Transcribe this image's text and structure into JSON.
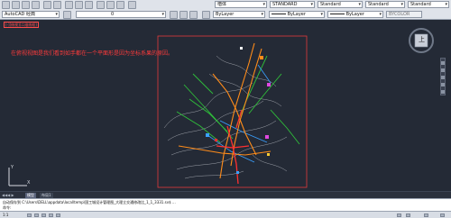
{
  "toolbar": {
    "workspace": "AutoCAD 经典",
    "layer_state": "0",
    "layer_dropdown": "ByLayer",
    "linetype_dropdown": "ByLayer",
    "lineweight_dropdown": "ByLayer",
    "plotstyle_dropdown": "BYCOLOR",
    "textstyle_dropdown": "STANDARD",
    "dimstyle_dropdown": "Standard",
    "tablestyle_dropdown": "Standard",
    "mleaderstyle_dropdown": "Standard",
    "font_dropdown": "楷体"
  },
  "viewport": {
    "label": "[-][俯视][二维线框]",
    "annotation": "在俯视视图是我们看到如手都在一个平面形是因为坐标系果的原因。",
    "viewcube_label": "上",
    "ucs_x": "X",
    "ucs_y": "Y"
  },
  "tabs": [
    {
      "label": "模型",
      "active": true
    },
    {
      "label": "布局1",
      "active": false
    }
  ],
  "command": {
    "line1": "自动保存到 C:\\Users\\DELL\\appdata\\local\\temp\\国工城设计管理图_大理立交通修改比_1_1_3331.sv$ ...",
    "line2": "命令:"
  },
  "status": {
    "coords": "1:1"
  },
  "colors": {
    "background": "#242a36",
    "frame": "#e23b3b",
    "road_orange": "#ff8c1a",
    "road_green": "#2fbf3a",
    "road_red": "#ff3030",
    "road_blue": "#3aa0ff",
    "terrain": "#c8cbd2"
  }
}
